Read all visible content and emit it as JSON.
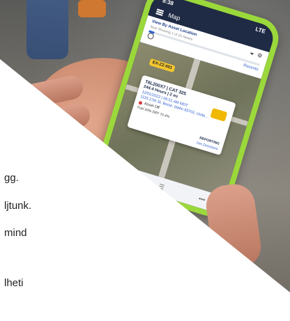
{
  "colors": {
    "phone_case": "#9bd83b",
    "brand_blue": "#2d5fcf",
    "tag_yellow": "#f4c62f",
    "alert_red": "#d63a3a"
  },
  "phone": {
    "status": {
      "time": "8:38",
      "signal": "LTE"
    },
    "appbar": {
      "title": "Map",
      "menu_icon": "hamburger-icon"
    },
    "panel": {
      "view_by": "View By Asset Location",
      "showing": "Now Showing 1 of 20 Assets",
      "recent": "Recents",
      "progress": 0.05
    },
    "map_tag": "EX-ZZ-001",
    "card": {
      "line1": "T6L200X7 | CAT 325",
      "line2": "244.4 Hours | 2 mi",
      "line3": "12/01/2022 | 06:51 AM MDT",
      "line4": "1115 27th St, Boise, Idaho 83702, Unite...",
      "status": "Asset Off",
      "fuel": "Fuel 20%  DEF 70.4%",
      "reporting": "REPORTING",
      "directions": "Get Directions"
    }
  },
  "text_lines": [
    "gg.",
    "ljtunk.",
    "mind",
    "lheti"
  ]
}
